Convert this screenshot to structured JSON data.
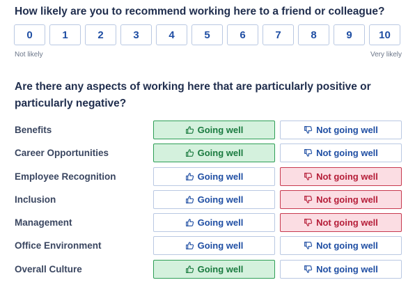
{
  "nps": {
    "question": "How likely are you to recommend working here to a friend or colleague?",
    "options": [
      "0",
      "1",
      "2",
      "3",
      "4",
      "5",
      "6",
      "7",
      "8",
      "9",
      "10"
    ],
    "low_label": "Not likely",
    "high_label": "Very likely"
  },
  "aspects": {
    "question": "Are there any aspects of working here that are particularly positive or particularly negative?",
    "good_label": "Going well",
    "bad_label": "Not going well",
    "rows": [
      {
        "label": "Benefits",
        "selected": "good"
      },
      {
        "label": "Career Opportunities",
        "selected": "good"
      },
      {
        "label": "Employee Recognition",
        "selected": "bad"
      },
      {
        "label": "Inclusion",
        "selected": "bad"
      },
      {
        "label": "Management",
        "selected": "bad"
      },
      {
        "label": "Office Environment",
        "selected": "none"
      },
      {
        "label": "Overall Culture",
        "selected": "good"
      }
    ]
  },
  "colors": {
    "accent": "#1f4ea3",
    "good_bg": "#d4f1dd",
    "good_border": "#2e9e56",
    "bad_bg": "#fbdde3",
    "bad_border": "#c7394f"
  },
  "icons": {
    "good": "thumbs-up-icon",
    "bad": "thumbs-down-icon"
  }
}
